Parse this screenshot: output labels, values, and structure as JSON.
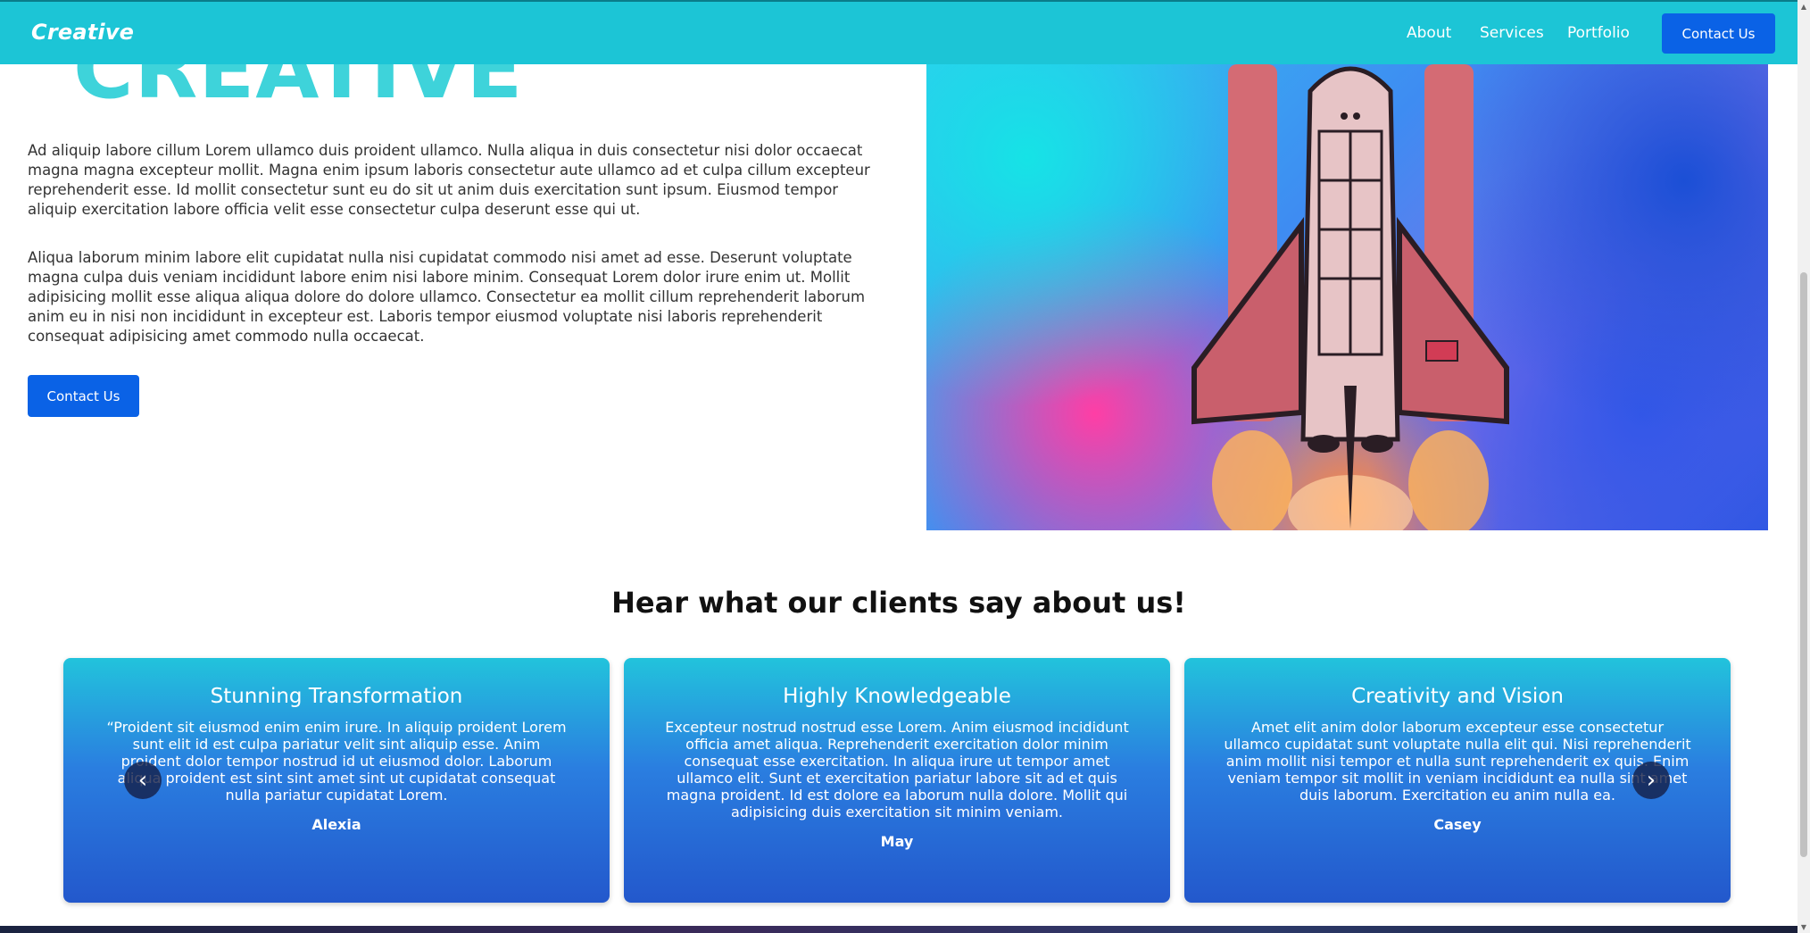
{
  "nav": {
    "brand": "Creative",
    "links": [
      "About",
      "Services",
      "Portfolio"
    ],
    "cta": "Contact Us"
  },
  "hero": {
    "heading": "CREATIVE",
    "paragraph_1": "Ad aliquip labore cillum Lorem ullamco duis proident ullamco. Nulla aliqua in duis consectetur nisi dolor occaecat magna magna excepteur mollit. Magna enim ipsum laboris consectetur aute ullamco ad et culpa cillum excepteur reprehenderit esse. Id mollit consectetur sunt eu do sit ut anim duis exercitation sunt ipsum. Eiusmod tempor aliquip exercitation labore officia velit esse consectetur culpa deserunt esse qui ut.",
    "paragraph_2": "Aliqua laborum minim labore elit cupidatat nulla nisi cupidatat commodo nisi amet ad esse. Deserunt voluptate magna culpa duis veniam incididunt labore enim nisi labore minim. Consequat Lorem dolor irure enim ut. Mollit adipisicing mollit esse aliqua aliqua dolore do dolore ullamco. Consectetur ea mollit cillum reprehenderit laborum anim eu in nisi non incididunt in excepteur est. Laboris tempor eiusmod voluptate nisi laboris reprehenderit consequat adipisicing amet commodo nulla occaecat.",
    "cta": "Contact Us"
  },
  "testimonials": {
    "title": "Hear what our clients say about us!",
    "cards": [
      {
        "title": "Stunning Transformation",
        "quote": "“Proident sit eiusmod enim enim irure. In aliquip proident Lorem sunt elit id est culpa pariatur velit sint aliquip esse. Anim proident dolor tempor nostrud id ut eiusmod dolor. Laborum aliqua proident est sint sint amet sint ut cupidatat consequat nulla pariatur cupidatat Lorem.",
        "author": "Alexia"
      },
      {
        "title": "Highly Knowledgeable",
        "quote": "Excepteur nostrud nostrud esse Lorem. Anim eiusmod incididunt officia amet aliqua. Reprehenderit exercitation dolor minim consequat esse exercitation. In aliqua irure ut tempor amet ullamco elit. Sunt et exercitation pariatur labore sit ad et quis magna proident. Id est dolore ea laborum nulla dolore. Mollit qui adipisicing duis exercitation sit minim veniam.",
        "author": "May"
      },
      {
        "title": "Creativity and Vision",
        "quote": "Amet elit anim dolor laborum excepteur esse consectetur ullamco cupidatat sunt voluptate nulla elit qui. Nisi reprehenderit anim mollit nisi tempor et nulla sunt reprehenderit ex quis. Enim veniam tempor sit mollit in veniam incididunt ea nulla sint amet duis laborum. Exercitation eu anim nulla ea.",
        "author": "Casey"
      }
    ],
    "prev_icon": "‹",
    "next_icon": "›"
  },
  "scrollbar": {
    "up_icon": "▲",
    "down_icon": "▼"
  },
  "colors": {
    "navbar": "#1cc5d6",
    "button": "#0a62e6",
    "heading_accent": "#3ed3da",
    "card_gradient_top": "#22c3dc",
    "card_gradient_bottom": "#2358cc"
  }
}
